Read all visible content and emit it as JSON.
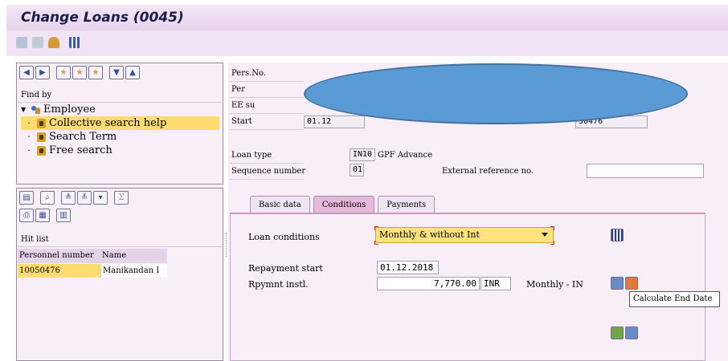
{
  "window": {
    "title": "Change Loans (0045)"
  },
  "colors": {
    "title_bg": "#e7d4ec",
    "selection": "#ffdc72",
    "dropdown": "#ffe27f",
    "overlay": "#5b9bd5"
  },
  "appbar": {
    "icons": [
      "back-icon",
      "forward-icon",
      "person-icon",
      "grid-icon"
    ]
  },
  "left_panel": {
    "find_by_label": "Find by",
    "tree": [
      {
        "label": "Employee",
        "level": 0,
        "icon": "employee-icon",
        "expanded": true
      },
      {
        "label": "Collective search help",
        "level": 1,
        "icon": "binoculars-icon",
        "selected": true
      },
      {
        "label": "Search Term",
        "level": 1,
        "icon": "binoculars-icon"
      },
      {
        "label": "Free search",
        "level": 1,
        "icon": "binoculars-icon"
      }
    ],
    "hit_list_label": "Hit list",
    "columns": [
      "Personnel number",
      "Name"
    ],
    "rows": [
      {
        "personnel_number": "10050476",
        "name": "Manikandan I"
      }
    ]
  },
  "header_fields": {
    "pers_no_label": "Pers.No.",
    "pers_label": "Per",
    "ee_label": "EE su",
    "start_label": "Start",
    "start_value": "01.12",
    "start_right_value": "50476",
    "loan_type_label": "Loan type",
    "loan_type_code": "IN10",
    "loan_type_text": "GPF Advance",
    "sequence_label": "Sequence number",
    "sequence_value": "01",
    "ext_ref_label": "External reference no.",
    "ext_ref_value": ""
  },
  "tabs": [
    {
      "label": "Basic data",
      "active": false
    },
    {
      "label": "Conditions",
      "active": true
    },
    {
      "label": "Payments",
      "active": false
    }
  ],
  "conditions": {
    "loan_conditions_label": "Loan conditions",
    "loan_conditions_value": "Monthly & without Int",
    "repayment_start_label": "Repayment start",
    "repayment_start_value": "01.12.2018",
    "rpymnt_label": "Rpymnt instl.",
    "rpymnt_value": "7,770.00",
    "currency": "INR",
    "frequency": "Monthly - IN",
    "tooltip": "Calculate End Date"
  }
}
